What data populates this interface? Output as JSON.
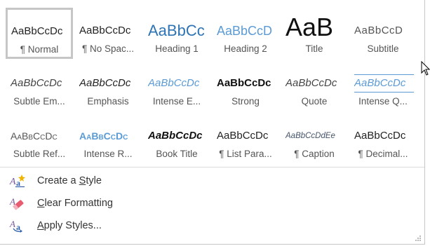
{
  "styles_gallery": {
    "rows": [
      [
        {
          "preview": "AaBbCcDc",
          "label": "¶ Normal",
          "selected": true
        },
        {
          "preview": "AaBbCcDc",
          "label": "¶ No Spac..."
        },
        {
          "preview": "AaBbCc",
          "label": "Heading 1"
        },
        {
          "preview": "AaBbCcD",
          "label": "Heading 2"
        },
        {
          "preview": "AaB",
          "label": "Title"
        },
        {
          "preview": "AaBbCcD",
          "label": "Subtitle"
        }
      ],
      [
        {
          "preview": "AaBbCcDc",
          "label": "Subtle Em..."
        },
        {
          "preview": "AaBbCcDc",
          "label": "Emphasis"
        },
        {
          "preview": "AaBbCcDc",
          "label": "Intense E..."
        },
        {
          "preview": "AaBbCcDc",
          "label": "Strong"
        },
        {
          "preview": "AaBbCcDc",
          "label": "Quote"
        },
        {
          "preview": "AaBbCcDc",
          "label": "Intense Q..."
        }
      ],
      [
        {
          "preview": "AaBbCcDc",
          "label": "Subtle Ref..."
        },
        {
          "preview": "AaBbCcDc",
          "label": "Intense R..."
        },
        {
          "preview": "AaBbCcDc",
          "label": "Book Title"
        },
        {
          "preview": "AaBbCcDc",
          "label": "¶ List Para..."
        },
        {
          "preview": "AaBbCcDdEe",
          "label": "¶ Caption"
        },
        {
          "preview": "AaBbCcDc",
          "label": "¶ Decimal..."
        }
      ]
    ]
  },
  "menu": {
    "create_style": {
      "before": "Create a ",
      "key": "S",
      "after": "tyle"
    },
    "clear_formatting": {
      "before": "",
      "key": "C",
      "after": "lear Formatting"
    },
    "apply_styles": {
      "before": "",
      "key": "A",
      "after": "pply Styles..."
    }
  },
  "icons": {
    "create_style": "create-style-icon",
    "clear_formatting": "eraser-icon",
    "apply_styles": "apply-styles-icon",
    "resize": "resize-gripper-icon",
    "cursor": "mouse-cursor-icon"
  },
  "colors": {
    "selected_border": "#c6c6c6",
    "accent_blue": "#5b9bd5",
    "dark_blue": "#2e74b5",
    "text": "#222222",
    "muted": "#555555"
  }
}
